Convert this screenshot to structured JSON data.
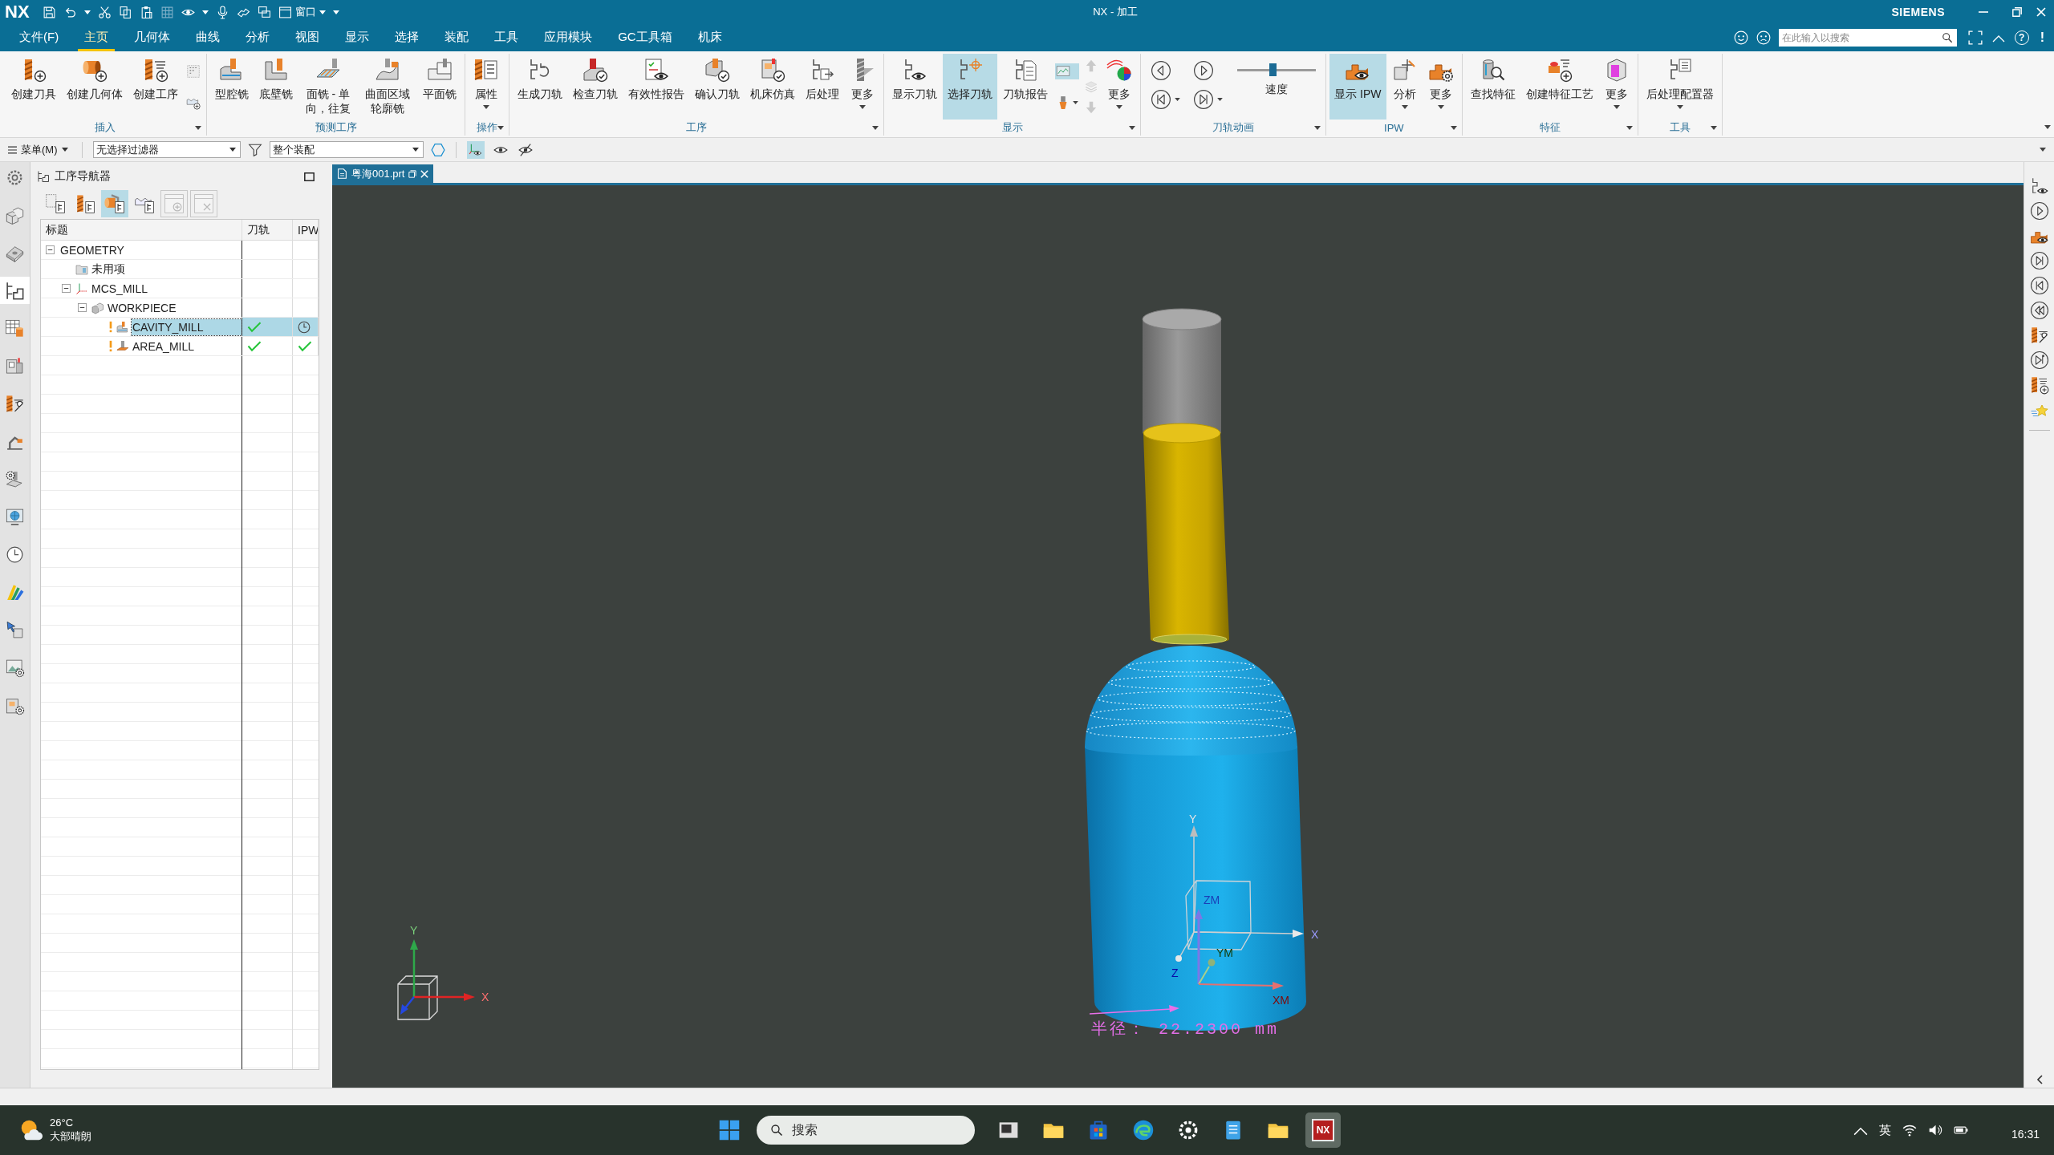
{
  "title_bar": {
    "logo": "NX",
    "window_menu": "窗口",
    "title": "NX - 加工",
    "brand": "SIEMENS"
  },
  "menu_tabs": [
    {
      "label": "文件(F)",
      "selected": false
    },
    {
      "label": "主页",
      "selected": true
    },
    {
      "label": "几何体",
      "selected": false
    },
    {
      "label": "曲线",
      "selected": false
    },
    {
      "label": "分析",
      "selected": false
    },
    {
      "label": "视图",
      "selected": false
    },
    {
      "label": "显示",
      "selected": false
    },
    {
      "label": "选择",
      "selected": false
    },
    {
      "label": "装配",
      "selected": false
    },
    {
      "label": "工具",
      "selected": false
    },
    {
      "label": "应用模块",
      "selected": false
    },
    {
      "label": "GC工具箱",
      "selected": false
    },
    {
      "label": "机床",
      "selected": false
    }
  ],
  "menu_bar": {
    "search": {
      "placeholder": "在此输入以搜索"
    },
    "help": "?",
    "notice": "!"
  },
  "ribbon": {
    "groups": [
      {
        "label": "插入",
        "menu": true,
        "items": [
          {
            "kind": "large",
            "label": "创建刀具",
            "on": false,
            "dropdown": false
          },
          {
            "kind": "large",
            "label": "创建几何体",
            "on": false,
            "dropdown": false
          },
          {
            "kind": "large",
            "label": "创建工序",
            "on": false,
            "dropdown": false
          },
          {
            "kind": "stack",
            "buttons": [
              {
                "on": false,
                "disabled": false,
                "dropdown": false
              },
              {
                "on": false,
                "disabled": false,
                "dropdown": false
              }
            ]
          }
        ]
      },
      {
        "label": "预测工序",
        "items": [
          {
            "kind": "large",
            "label": "型腔铣",
            "on": false,
            "dropdown": false
          },
          {
            "kind": "large",
            "label": "底壁铣",
            "on": false,
            "dropdown": false
          },
          {
            "kind": "large",
            "label": "面铣 - 单向，往复",
            "on": false,
            "dropdown": false
          },
          {
            "kind": "large",
            "label": "曲面区域轮廓铣",
            "on": false,
            "dropdown": false
          },
          {
            "kind": "large",
            "label": "平面铣",
            "on": false,
            "dropdown": false
          }
        ]
      },
      {
        "label": "操作",
        "menu": true,
        "items": [
          {
            "kind": "large",
            "label": "属性",
            "on": false,
            "dropdown": true
          }
        ]
      },
      {
        "label": "工序",
        "menu": true,
        "items": [
          {
            "kind": "large",
            "label": "生成刀轨",
            "on": false,
            "dropdown": false
          },
          {
            "kind": "large",
            "label": "检查刀轨",
            "on": false,
            "dropdown": false
          },
          {
            "kind": "large",
            "label": "有效性报告",
            "on": false,
            "dropdown": false
          },
          {
            "kind": "large",
            "label": "确认刀轨",
            "on": false,
            "dropdown": false
          },
          {
            "kind": "large",
            "label": "机床仿真",
            "on": false,
            "dropdown": false
          },
          {
            "kind": "large",
            "label": "后处理",
            "on": false,
            "dropdown": false
          },
          {
            "kind": "large",
            "label": "更多",
            "on": false,
            "dropdown": true
          }
        ]
      },
      {
        "label": "显示",
        "menu": true,
        "items": [
          {
            "kind": "large",
            "label": "显示刀轨",
            "on": false,
            "dropdown": false
          },
          {
            "kind": "large",
            "label": "选择刀轨",
            "on": true,
            "dropdown": false
          },
          {
            "kind": "large",
            "label": "刀轨报告",
            "on": false,
            "dropdown": false
          },
          {
            "kind": "stack",
            "buttons": [
              {
                "on": true,
                "disabled": false,
                "dropdown": false
              },
              {
                "on": false,
                "disabled": false,
                "dropdown": true
              }
            ]
          },
          {
            "kind": "stack",
            "buttons": [
              {
                "on": false,
                "disabled": true,
                "dropdown": false
              },
              {
                "on": false,
                "disabled": true,
                "dropdown": false
              },
              {
                "on": false,
                "disabled": true,
                "dropdown": false
              }
            ]
          },
          {
            "kind": "large",
            "label": "更多",
            "on": false,
            "dropdown": true
          }
        ]
      },
      {
        "label": "刀轨动画",
        "menu": true,
        "items": [
          {
            "kind": "animation",
            "buttons": [
              {
                "dropdown": false
              },
              {
                "dropdown": false
              },
              {
                "dropdown": true
              },
              {
                "dropdown": true
              }
            ],
            "slider": {
              "label": "速度",
              "level": 0.45
            }
          }
        ]
      },
      {
        "label": "IPW",
        "menu": true,
        "items": [
          {
            "kind": "large",
            "label": "显示 IPW",
            "on": true,
            "dropdown": false
          },
          {
            "kind": "large",
            "label": "分析",
            "on": false,
            "dropdown": true
          },
          {
            "kind": "large",
            "label": "更多",
            "on": false,
            "dropdown": true
          }
        ]
      },
      {
        "label": "特征",
        "menu": true,
        "items": [
          {
            "kind": "large",
            "label": "查找特征",
            "on": false,
            "dropdown": false
          },
          {
            "kind": "large",
            "label": "创建特征工艺",
            "on": false,
            "dropdown": false
          },
          {
            "kind": "large",
            "label": "更多",
            "on": false,
            "dropdown": true
          }
        ]
      },
      {
        "label": "工具",
        "menu": true,
        "items": [
          {
            "kind": "large",
            "label": "后处理配置器",
            "on": false,
            "dropdown": true
          }
        ]
      }
    ]
  },
  "selection_bar": {
    "menu": "菜单(M)",
    "filter": "无选择过滤器",
    "scope": "整个装配",
    "toggles": [
      {
        "on": true
      },
      {
        "on": false
      },
      {
        "on": false
      }
    ]
  },
  "left_tabs": [
    {
      "selected": false
    },
    {
      "selected": false
    },
    {
      "selected": false
    },
    {
      "selected": true
    },
    {
      "selected": false
    },
    {
      "selected": false
    },
    {
      "selected": false
    },
    {
      "selected": false
    },
    {
      "selected": false
    },
    {
      "selected": false
    },
    {
      "selected": false
    },
    {
      "selected": false
    },
    {
      "selected": false
    },
    {
      "selected": false
    },
    {
      "selected": false
    }
  ],
  "navigator": {
    "title": "工序导航器",
    "toolbar": [
      {
        "on": false,
        "disabled": false
      },
      {
        "on": false,
        "disabled": false
      },
      {
        "on": true,
        "disabled": false
      },
      {
        "on": false,
        "disabled": false
      },
      {
        "on": false,
        "disabled": true
      },
      {
        "on": false,
        "disabled": true
      }
    ],
    "columns": [
      "标题",
      "刀轨",
      "IPW"
    ],
    "tree": [
      {
        "name": "GEOMETRY",
        "kind": "root",
        "selected": false,
        "expanded": true,
        "children": [
          {
            "name": "未用项",
            "kind": "folder",
            "selected": false
          },
          {
            "name": "MCS_MILL",
            "kind": "mcs",
            "selected": false,
            "expanded": true,
            "children": [
              {
                "name": "WORKPIECE",
                "kind": "workpiece",
                "selected": false,
                "expanded": true,
                "children": [
                  {
                    "name": "CAVITY_MILL",
                    "kind": "cavity",
                    "selected": true,
                    "warning": true,
                    "toolpath_done": true,
                    "ipw_done": false
                  },
                  {
                    "name": "AREA_MILL",
                    "kind": "contour",
                    "selected": false,
                    "warning": true,
                    "toolpath_done": true,
                    "ipw_done": true
                  }
                ]
              }
            ]
          }
        ]
      }
    ]
  },
  "viewport": {
    "tab": {
      "label": "粤海001.prt",
      "selected": true
    },
    "wcs_axes": [
      "Y",
      "X",
      "Z"
    ],
    "mcs_axes": [
      "ZM",
      "YM",
      "XM"
    ],
    "view_triad_axes": [
      "Y",
      "X"
    ],
    "dimension": "半径： 22.2300 mm"
  },
  "taskbar": {
    "weather": {
      "temperature": "26°C",
      "condition": "大部晴朗"
    },
    "search": {
      "placeholder": "搜索"
    },
    "apps": [
      {
        "selected": false
      },
      {
        "selected": false
      },
      {
        "selected": false
      },
      {
        "selected": false
      },
      {
        "selected": false
      },
      {
        "selected": false
      },
      {
        "selected": false
      },
      {
        "label": "NX",
        "selected": true
      }
    ],
    "tray": {
      "input_method": "英",
      "time": "16:31"
    }
  }
}
